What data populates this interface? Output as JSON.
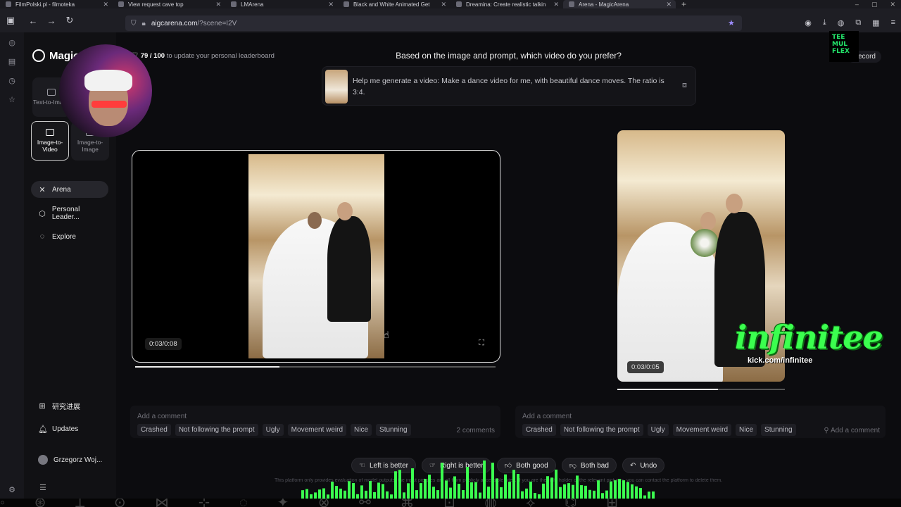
{
  "browser": {
    "tabs": [
      {
        "title": "FilmPolski.pl - filmoteka",
        "active": false
      },
      {
        "title": "View request cave top",
        "active": false
      },
      {
        "title": "LMArena",
        "active": false
      },
      {
        "title": "Black and White Animated Get",
        "active": false
      },
      {
        "title": "Dreamina: Create realistic talkin",
        "active": false
      },
      {
        "title": "Arena - MagicArena",
        "active": true
      }
    ],
    "url_host": "aigcarena.com",
    "url_path": "/?scene=I2V"
  },
  "sidebar": {
    "brand": "Magic",
    "modes": [
      {
        "label": "Text-to-Image",
        "active": false
      },
      {
        "label": "Image-to-Video",
        "active": true
      },
      {
        "label": "Image-to-Image",
        "active": false
      }
    ],
    "nav": [
      {
        "label": "Arena",
        "icon": "arena-icon",
        "active": true
      },
      {
        "label": "Personal Leader...",
        "icon": "leaderboard-icon",
        "active": false
      },
      {
        "label": "Explore",
        "icon": "explore-icon",
        "active": false
      }
    ],
    "research": "研究进展",
    "updates": "Updates",
    "user_name": "Grzegorz Woj..."
  },
  "main": {
    "progress_value": "79 / 100",
    "progress_suffix": "to update your personal leaderboard",
    "question": "Based on the image and prompt, which video do you prefer?",
    "record": "Record",
    "prompt": "Help me generate a video: Make a dance video for me, with beautiful dance moves. The ratio is 3:4.",
    "left_video": {
      "time": "0:03/0:08",
      "progress": 0.4
    },
    "right_video": {
      "time": "0:03/0:05",
      "progress": 0.6
    },
    "left_comment": {
      "placeholder": "Add a comment",
      "count": "2 comments"
    },
    "right_comment": {
      "placeholder": "Add a comment",
      "action": "Add a comment"
    },
    "tags": [
      "Crashed",
      "Not following the prompt",
      "Ugly",
      "Movement weird",
      "Nice",
      "Stunning"
    ],
    "votes": [
      {
        "label": "Left is better",
        "icon": "hand-left-icon"
      },
      {
        "label": "Right is better",
        "icon": "hand-right-icon"
      },
      {
        "label": "Both good",
        "icon": "thumbs-up-icon"
      },
      {
        "label": "Both bad",
        "icon": "thumbs-down-icon"
      },
      {
        "label": "Undo",
        "icon": "undo-icon"
      }
    ],
    "disclaimer": "This platform only provides evaluation of model outputs; the input pictures are all from publicly accessible sites. If you are the right holder of the relevant pictures, you can contact the platform to delete them."
  },
  "overlay": {
    "logo_text": "TEE MUL FLEX",
    "watermark": "infinitee",
    "watermark_sub": "kick.com/infinitee"
  },
  "colors": {
    "accent_green": "#3bff4f",
    "bg": "#0c0c0f",
    "sidebar": "#111114"
  }
}
